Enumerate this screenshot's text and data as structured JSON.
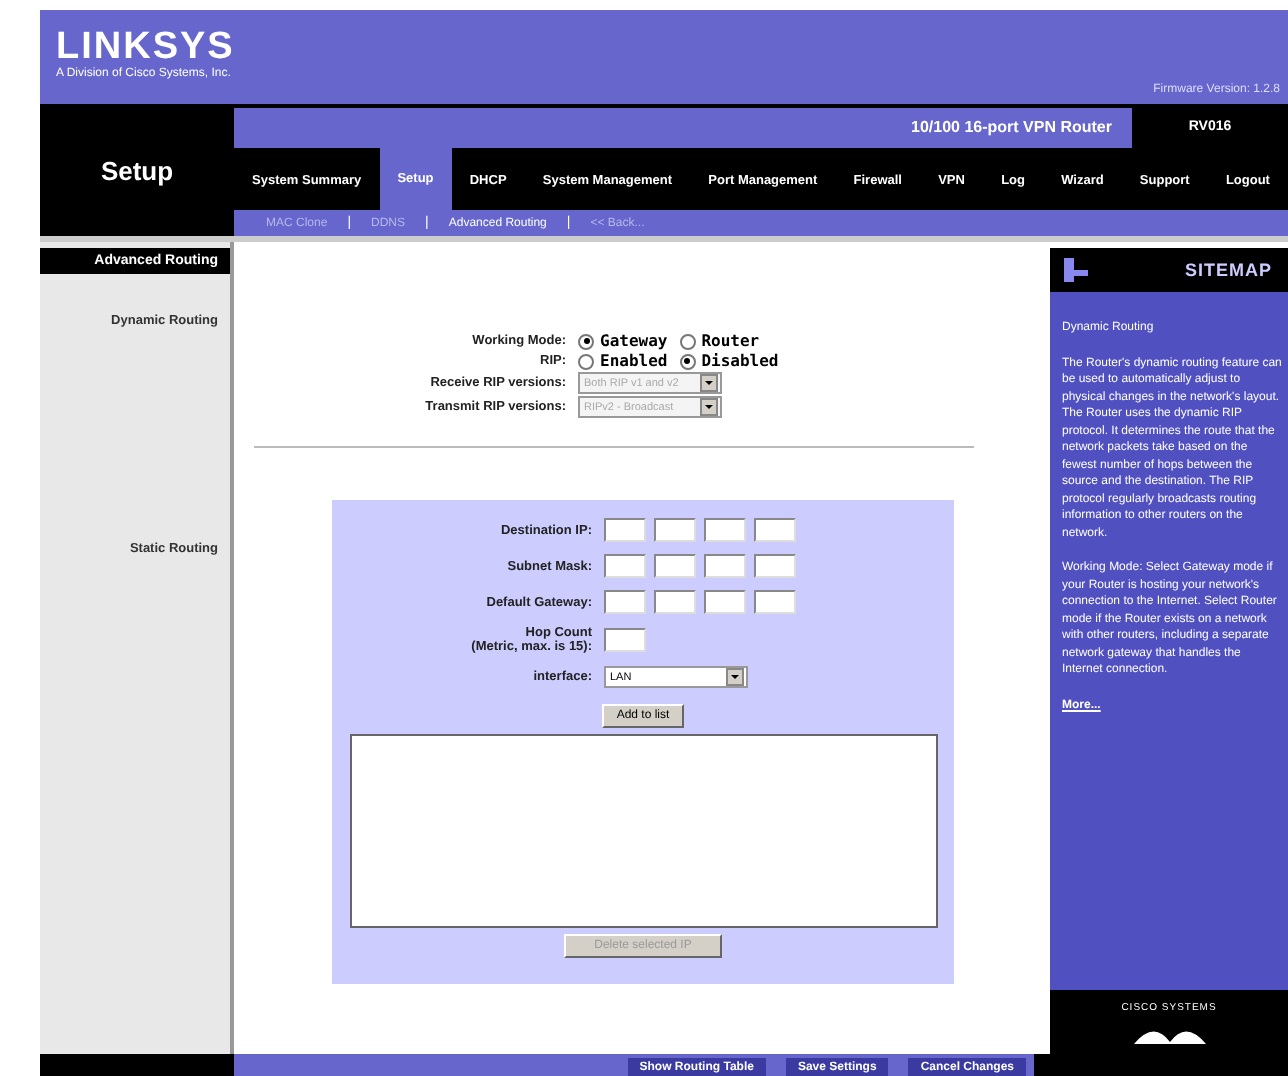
{
  "header": {
    "logo": "LINKSYS",
    "tagline": "A Division of Cisco Systems, Inc.",
    "firmware": "Firmware Version: 1.2.8"
  },
  "section_title": "Setup",
  "product": {
    "name": "10/100 16-port VPN Router",
    "model": "RV016"
  },
  "tabs": [
    {
      "label": "System Summary",
      "selected": false
    },
    {
      "label": "Setup",
      "selected": true
    },
    {
      "label": "DHCP",
      "selected": false
    },
    {
      "label": "System Management",
      "selected": false
    },
    {
      "label": "Port Management",
      "selected": false
    },
    {
      "label": "Firewall",
      "selected": false
    },
    {
      "label": "VPN",
      "selected": false
    },
    {
      "label": "Log",
      "selected": false
    },
    {
      "label": "Wizard",
      "selected": false
    },
    {
      "label": "Support",
      "selected": false
    },
    {
      "label": "Logout",
      "selected": false
    }
  ],
  "subtab_separator": "|",
  "subtabs": [
    {
      "label": "MAC Clone",
      "selected": false
    },
    {
      "label": "DDNS",
      "selected": false
    },
    {
      "label": "Advanced Routing",
      "selected": true
    },
    {
      "label": "<< Back...",
      "selected": false
    }
  ],
  "sidebar": {
    "title": "Advanced Routing",
    "sections": [
      "Dynamic Routing",
      "Static Routing"
    ]
  },
  "dynamic_routing": [
    {
      "kind": "radio",
      "label": "Working Mode:",
      "options": [
        {
          "label": "Gateway",
          "selected": true
        },
        {
          "label": "Router",
          "selected": false
        }
      ]
    },
    {
      "kind": "radio",
      "label": "RIP:",
      "options": [
        {
          "label": "Enabled",
          "selected": false
        },
        {
          "label": "Disabled",
          "selected": true
        }
      ]
    },
    {
      "kind": "select",
      "label": "Receive RIP versions:",
      "value": "Both RIP v1 and v2",
      "disabled": true
    },
    {
      "kind": "select",
      "label": "Transmit RIP versions:",
      "value": "RIPv2 - Broadcast",
      "disabled": true
    }
  ],
  "static_routing": {
    "fields": [
      {
        "kind": "ip",
        "label": "Destination IP:"
      },
      {
        "kind": "ip",
        "label": "Subnet Mask:"
      },
      {
        "kind": "ip",
        "label": "Default Gateway:"
      },
      {
        "kind": "text",
        "label": "Hop Count",
        "sublabel": "(Metric, max. is 15):"
      },
      {
        "kind": "select",
        "label": "interface:",
        "value": "LAN"
      }
    ],
    "add_button": "Add to list",
    "delete_button": {
      "label": "Delete selected IP",
      "disabled": true
    }
  },
  "sitemap": {
    "title": "SITEMAP",
    "heading": "Dynamic Routing",
    "paragraphs": [
      "The Router's dynamic routing feature can be used to automatically adjust to physical changes in the network's layout. The Router uses the dynamic RIP protocol. It determines the route that the network packets take based on the fewest number of hops between the source and the destination. The RIP protocol regularly broadcasts routing information to other routers on the network.",
      "Working Mode: Select Gateway mode if your Router is hosting your network's connection to the Internet. Select Router mode if the Router exists on a network with other routers, including a separate network gateway that handles the Internet connection."
    ],
    "more_link": "More...",
    "brand": "CISCO SYSTEMS"
  },
  "footer_buttons": [
    "Show Routing Table",
    "Save Settings",
    "Cancel Changes"
  ]
}
